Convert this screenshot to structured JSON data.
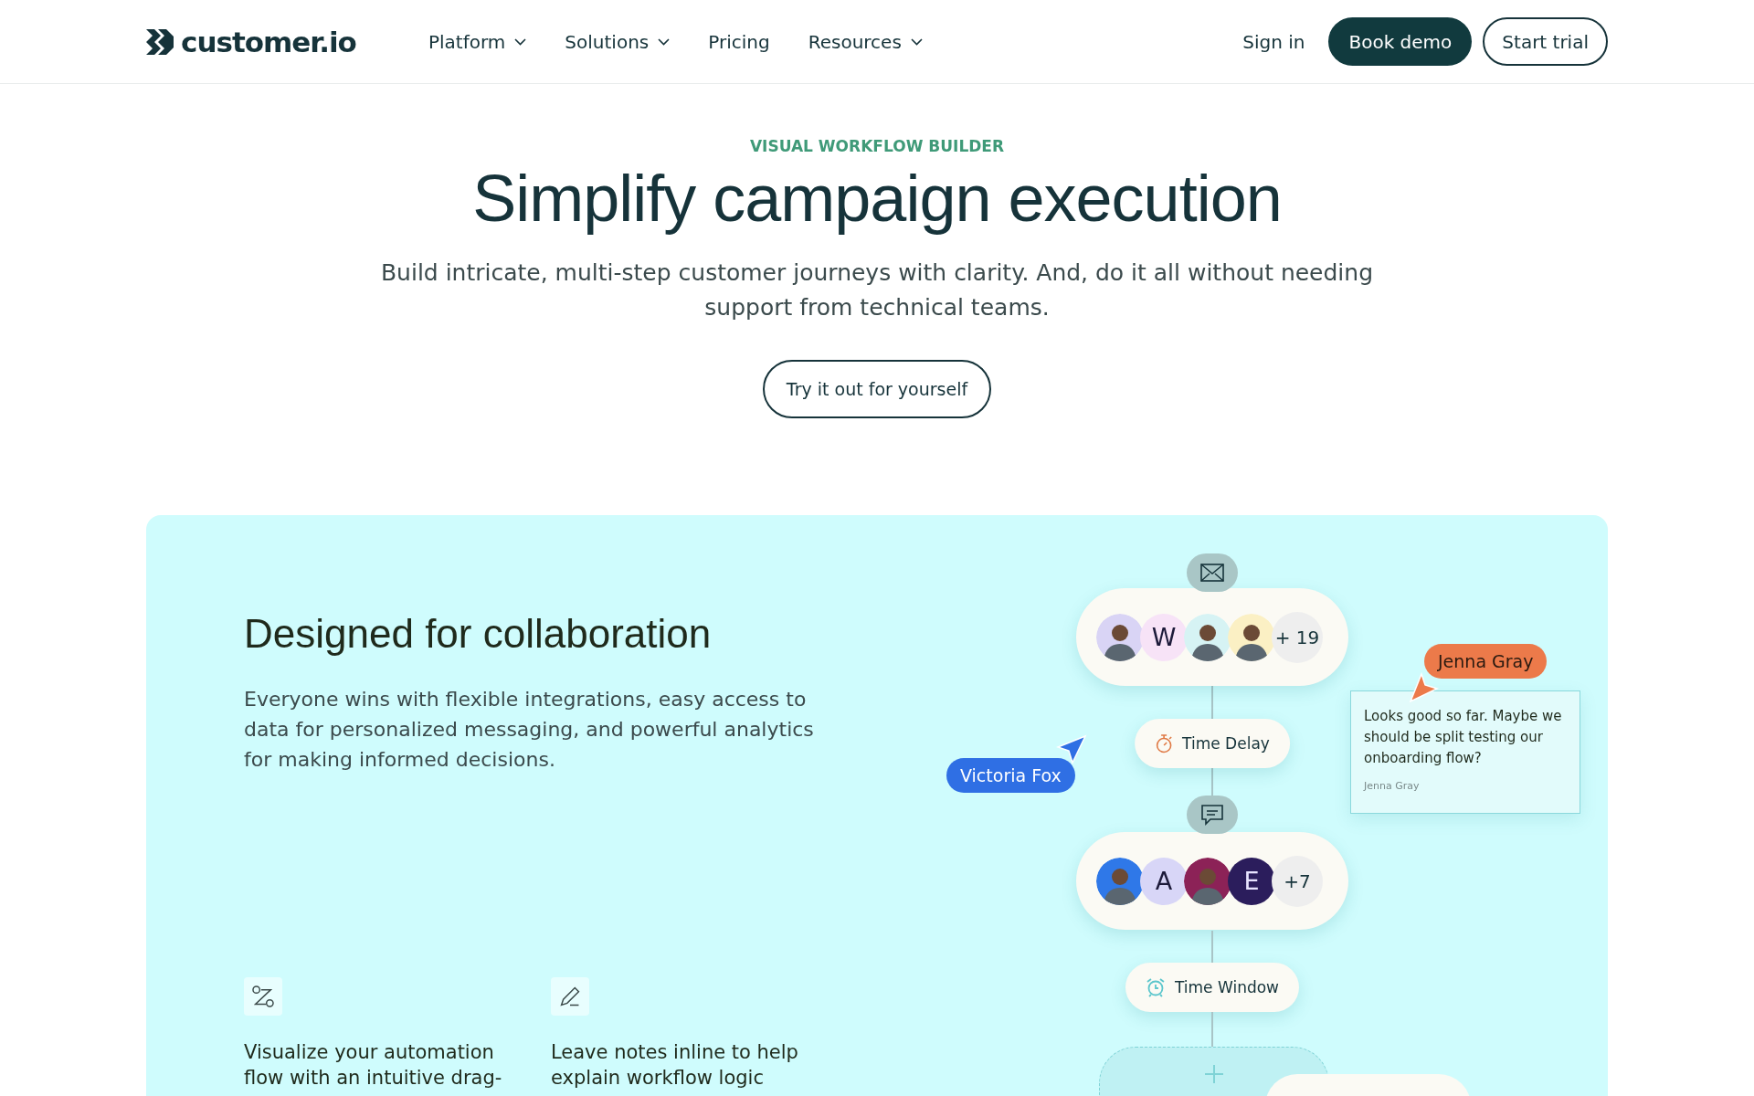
{
  "header": {
    "logo": "customer.io",
    "nav": [
      {
        "label": "Platform",
        "has_menu": true
      },
      {
        "label": "Solutions",
        "has_menu": true
      },
      {
        "label": "Pricing",
        "has_menu": false
      },
      {
        "label": "Resources",
        "has_menu": true
      }
    ],
    "sign_in": "Sign in",
    "book_demo": "Book demo",
    "start_trial": "Start trial"
  },
  "hero": {
    "eyebrow": "VISUAL WORKFLOW BUILDER",
    "title": "Simplify campaign execution",
    "subtitle": "Build intricate, multi-step customer journeys with clarity. And, do it all without needing support from technical teams.",
    "button": "Try it out for yourself"
  },
  "feature": {
    "title": "Designed for collaboration",
    "text": "Everyone wins with flexible integrations, easy access to data for personalized messaging, and powerful analytics for making informed decisions.",
    "points": [
      {
        "kind": "path",
        "text": "Visualize your automation flow with an intuitive drag-"
      },
      {
        "kind": "pencil",
        "text": "Leave notes inline to help explain workflow logic"
      }
    ],
    "workflow": {
      "groups": [
        {
          "kind": "email",
          "members": [
            {
              "kind": "photo",
              "color": "#d9d4f5"
            },
            {
              "kind": "letter",
              "letter": "W",
              "color": "#f7e3f7"
            },
            {
              "kind": "photo",
              "color": "#d6f3f4"
            },
            {
              "kind": "photo",
              "color": "#fbf0c4"
            },
            {
              "kind": "count",
              "letter": "+ 19",
              "color": "#eeeeee"
            }
          ]
        },
        {
          "kind": "chat",
          "members": [
            {
              "kind": "photo",
              "color": "#2f78e8"
            },
            {
              "kind": "letter",
              "letter": "A",
              "color": "#d8d6f7"
            },
            {
              "kind": "photo",
              "color": "#8c2257"
            },
            {
              "kind": "letter",
              "letter": "E",
              "color": "#2b1d5c"
            },
            {
              "kind": "count",
              "letter": "+7",
              "color": "#eeeeee"
            }
          ]
        }
      ],
      "steps": [
        {
          "kind": "delay",
          "label": "Time Delay"
        },
        {
          "kind": "window",
          "label": "Time Window"
        }
      ],
      "cursors": [
        {
          "name": "Victoria Fox",
          "color": "#2f6fe4"
        },
        {
          "name": "Jenna Gray",
          "color": "#ec7a4a"
        }
      ],
      "comment": {
        "text": "Looks good so far. Maybe we should be split testing our onboarding flow?",
        "author": "Jenna Gray"
      }
    }
  }
}
